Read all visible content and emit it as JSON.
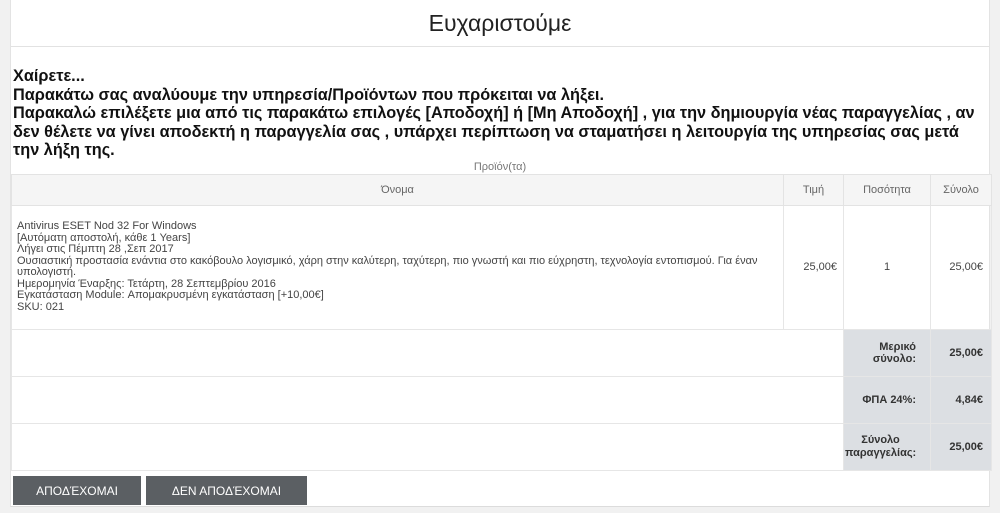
{
  "header": {
    "title": "Ευχαριστούμε"
  },
  "intro": {
    "greeting": "Χαίρετε...",
    "line1": "Παρακάτω σας αναλύουμε την υπηρεσία/Προϊόντων που πρόκειται να λήξει.",
    "line2": "Παρακαλώ επιλέξετε μια από τις παρακάτω επιλογές [Αποδοχή] ή [Μη Αποδοχή] , για την δημιουργία νέας παραγγελίας , αν δεν θέλετε να γίνει αποδεκτή η παραγγελία σας , υπάρχει περίπτωση να σταματήσει η λειτουργία της υπηρεσίας σας μετά την λήξη της."
  },
  "products": {
    "caption": "Προϊόν(τα)",
    "columns": {
      "name": "Όνομα",
      "price": "Τιμή",
      "qty": "Ποσότητα",
      "total": "Σύνολο"
    },
    "items": [
      {
        "lines": [
          "Antivirus ESET Nod 32 For Windows",
          "[Αυτόματη αποστολή, κάθε 1 Years]",
          "Λήγει στις Πέμπτη 28 ,Σεπ 2017",
          "Ουσιαστική προστασία ενάντια στο κακόβουλο λογισμικό, χάρη στην καλύτερη, ταχύτερη, πιο γνωστή και πιο εύχρηστη,  τεχνολογία εντοπισμού. Για έναν υπολογιστή.",
          "Ημερομηνία Έναρξης: Τετάρτη, 28 Σεπτεμβρίου 2016",
          "Εγκατάσταση Module: Απομακρυσμένη εγκατάσταση [+10,00€]",
          "SKU: 021"
        ],
        "price": "25,00€",
        "qty": "1",
        "total": "25,00€"
      }
    ],
    "totals": {
      "subtotal_label": "Μερικό σύνολο:",
      "subtotal_value": "25,00€",
      "vat_label": "ΦΠΑ 24%:",
      "vat_value": "4,84€",
      "grand_label": "Σύνολο παραγγελίας:",
      "grand_value": "25,00€"
    }
  },
  "actions": {
    "accept_label": "ΑΠΟΔΈΧΟΜΑΙ",
    "decline_label": "ΔΕΝ ΑΠΟΔΈΧΟΜΑΙ"
  }
}
